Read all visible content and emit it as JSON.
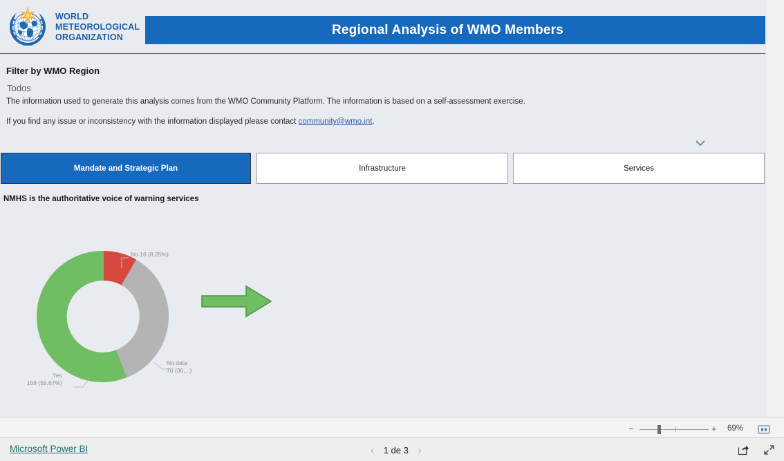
{
  "header": {
    "logo_alt": "World Meteorological Organization",
    "logo_lines": [
      "WORLD",
      "METEOROLOGICAL",
      "ORGANIZATION"
    ],
    "title": "Regional Analysis of WMO Members"
  },
  "filter": {
    "label": "Filter by WMO Region",
    "value": "Todos",
    "chevron_icon": "chevron-down-icon",
    "note_line1": "The information used to generate this analysis comes from the WMO Community Platform. The information is based on a self-assessment exercise.",
    "note_line2_before": "If you find any issue or inconsistency with the information displayed please contact ",
    "note_line2_link": "community@wmo.int",
    "note_line2_after": "."
  },
  "tabs": [
    {
      "label": "Mandate and Strategic Plan",
      "active": true
    },
    {
      "label": "Infrastructure",
      "active": false
    },
    {
      "label": "Services",
      "active": false
    }
  ],
  "visual": {
    "title": "NMHS is the authoritative voice of warning services",
    "arrow_icon": "right-arrow-shape"
  },
  "chart_data": {
    "type": "pie",
    "variant": "donut",
    "title": "NMHS is the authoritative voice of warning services",
    "labels": [
      "No",
      "No data",
      "Yes"
    ],
    "values": [
      16,
      70,
      108
    ],
    "percents": [
      "8,25%",
      "36,08%",
      "55,67%"
    ],
    "colors": [
      "#d7483f",
      "#b4b4b4",
      "#70bd63"
    ],
    "data_labels": [
      {
        "name": "No",
        "text_line1": "No 16 (8,25%)",
        "text_line2": ""
      },
      {
        "name": "No data",
        "text_line1": "No data",
        "text_line2": "70 (36,...)"
      },
      {
        "name": "Yes",
        "text_line1": "Yes",
        "text_line2": "108 (55,67%)"
      }
    ],
    "legend": "none",
    "grid": false,
    "start_angle_deg": 0,
    "total": 194
  },
  "zoombar": {
    "minus": "−",
    "plus": "+",
    "percent": "69%",
    "fit_icon": "fit-to-page-icon"
  },
  "footer": {
    "powerbi_label": "Microsoft Power BI",
    "prev_icon": "‹",
    "page_label": "1 de 3",
    "next_icon": "›",
    "share_icon": "share-icon",
    "fullscreen_icon": "fullscreen-icon"
  },
  "colors": {
    "brand_blue": "#1769be",
    "page_bg": "#e8ebef",
    "green": "#70bd63",
    "red": "#d7483f",
    "gray": "#b4b4b4",
    "link_teal": "#1b6b72"
  }
}
